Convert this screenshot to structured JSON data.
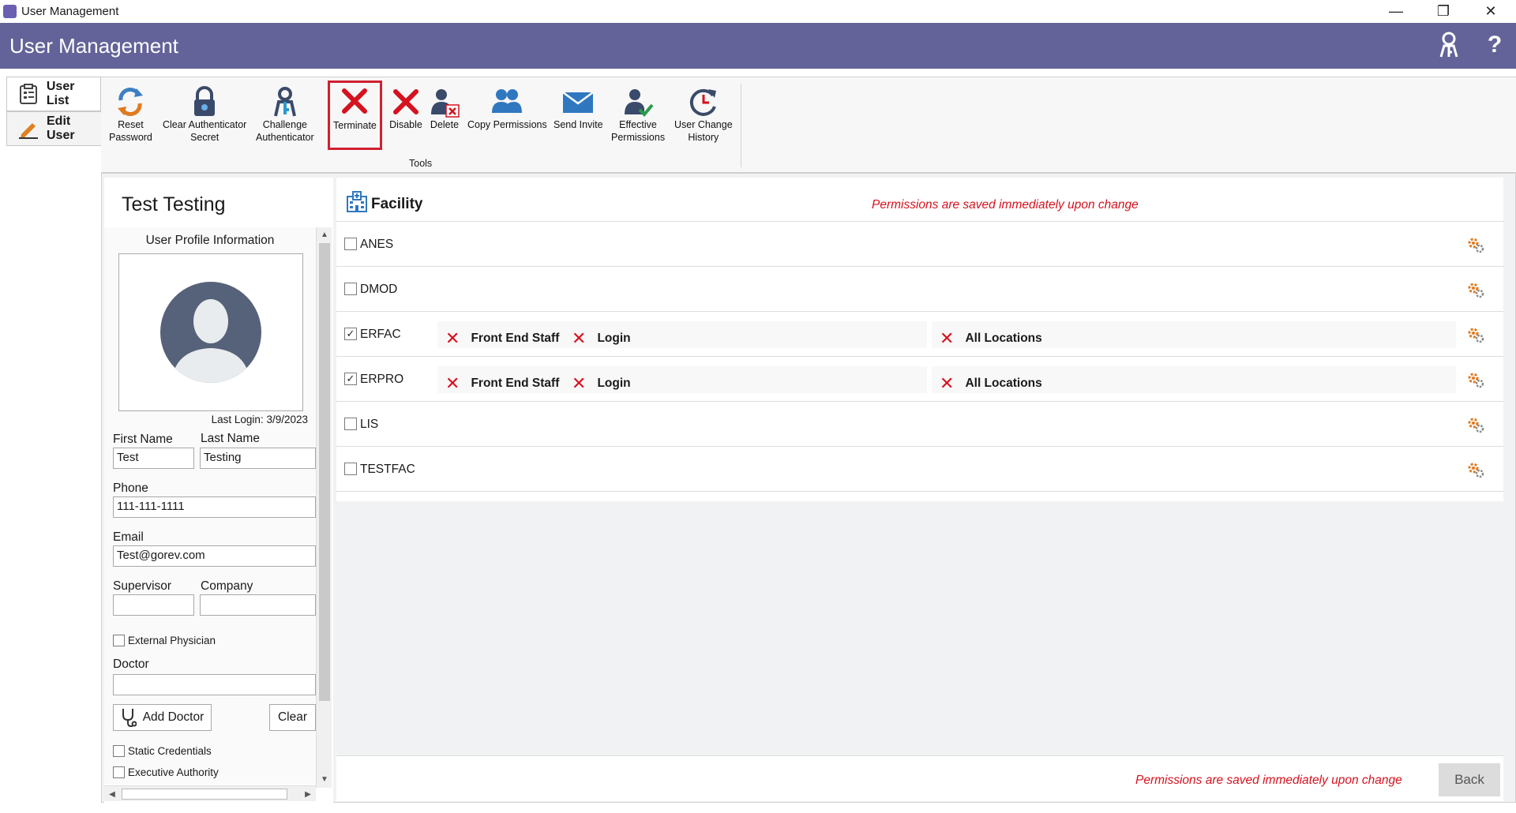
{
  "window": {
    "title": "User Management"
  },
  "header": {
    "title": "User Management"
  },
  "nav": {
    "tabs": [
      {
        "label": "User List"
      },
      {
        "label": "Edit User"
      }
    ]
  },
  "ribbon": {
    "group_label": "Tools",
    "buttons": [
      {
        "line1": "Reset",
        "line2": "Password",
        "icon": "reset-password-icon"
      },
      {
        "line1": "Clear Authenticator",
        "line2": "Secret",
        "icon": "lock-icon"
      },
      {
        "line1": "Challenge",
        "line2": "Authenticator",
        "icon": "authenticator-user-icon"
      },
      {
        "line1": "Terminate",
        "line2": "",
        "icon": "terminate-x-icon"
      },
      {
        "line1": "Disable",
        "line2": "",
        "icon": "disable-x-icon"
      },
      {
        "line1": "Delete",
        "line2": "",
        "icon": "delete-user-icon"
      },
      {
        "line1": "Copy Permissions",
        "line2": "",
        "icon": "copy-users-icon"
      },
      {
        "line1": "Send Invite",
        "line2": "",
        "icon": "envelope-icon"
      },
      {
        "line1": "Effective",
        "line2": "Permissions",
        "icon": "user-check-icon"
      },
      {
        "line1": "User Change",
        "line2": "History",
        "icon": "history-icon"
      }
    ]
  },
  "profile": {
    "name": "Test Testing",
    "section_title": "User Profile Information",
    "last_login": "Last Login: 3/9/2023",
    "first_name_label": "First Name",
    "first_name": "Test",
    "last_name_label": "Last Name",
    "last_name": "Testing",
    "phone_label": "Phone",
    "phone": "111-111-1111",
    "email_label": "Email",
    "email": "Test@gorev.com",
    "supervisor_label": "Supervisor",
    "supervisor": "",
    "company_label": "Company",
    "company": "",
    "external_physician_label": "External Physician",
    "doctor_label": "Doctor",
    "doctor": "",
    "add_doctor_label": "Add Doctor",
    "clear_label": "Clear",
    "static_credentials_label": "Static Credentials",
    "executive_authority_label": "Executive Authority"
  },
  "facility": {
    "title": "Facility",
    "notice": "Permissions are saved immediately upon change",
    "rows": [
      {
        "name": "ANES",
        "checked": false
      },
      {
        "name": "DMOD",
        "checked": false
      },
      {
        "name": "ERFAC",
        "checked": true,
        "roles": [
          "Front End Staff",
          "Login"
        ],
        "locations": "All Locations"
      },
      {
        "name": "ERPRO",
        "checked": true,
        "roles": [
          "Front End Staff",
          "Login"
        ],
        "locations": "All Locations"
      },
      {
        "name": "LIS",
        "checked": false
      },
      {
        "name": "TESTFAC",
        "checked": false
      }
    ]
  },
  "footer": {
    "notice": "Permissions are saved immediately upon change",
    "back_label": "Back"
  },
  "colors": {
    "header_bg": "#63639a",
    "accent_red": "#d5121e"
  }
}
